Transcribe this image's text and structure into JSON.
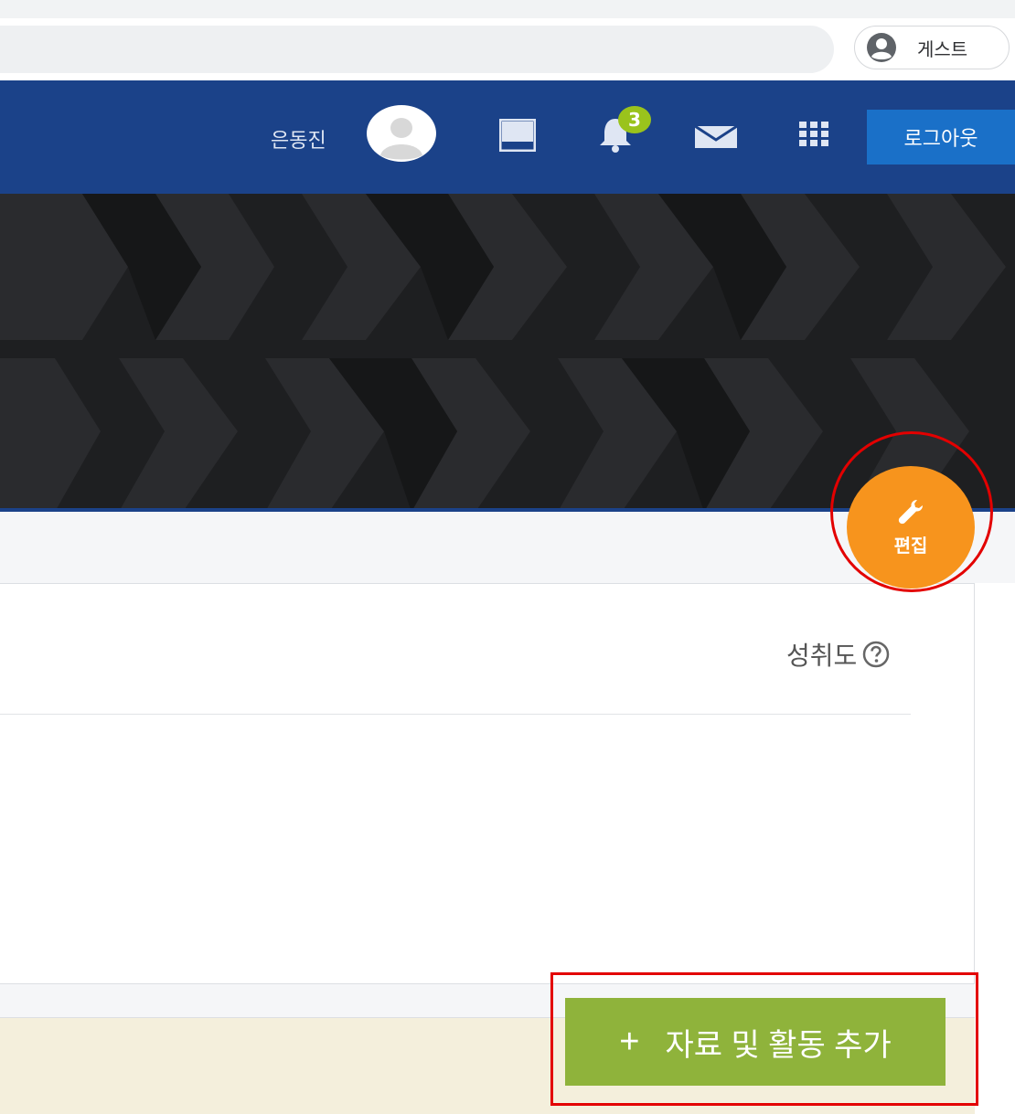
{
  "browser": {
    "guest_label": "게스트"
  },
  "navbar": {
    "user_name": "은동진",
    "notification_count": "3",
    "logout_label": "로그아웃"
  },
  "edit_button": {
    "label": "편집"
  },
  "course": {
    "achievement_label": "성취도"
  },
  "add_activity": {
    "plus": "+",
    "label": "자료 및 활동 추가"
  },
  "colors": {
    "navbar": "#1b4289",
    "logout": "#1a70c8",
    "edit_fab": "#f7941d",
    "add_button": "#8fb33b",
    "badge": "#9ac31c",
    "highlight": "#e30000"
  },
  "icons": [
    "account-circle-icon",
    "avatar-icon",
    "dock-panel-icon",
    "bell-icon",
    "envelope-icon",
    "apps-grid-icon",
    "wrench-icon",
    "help-circle-icon"
  ]
}
